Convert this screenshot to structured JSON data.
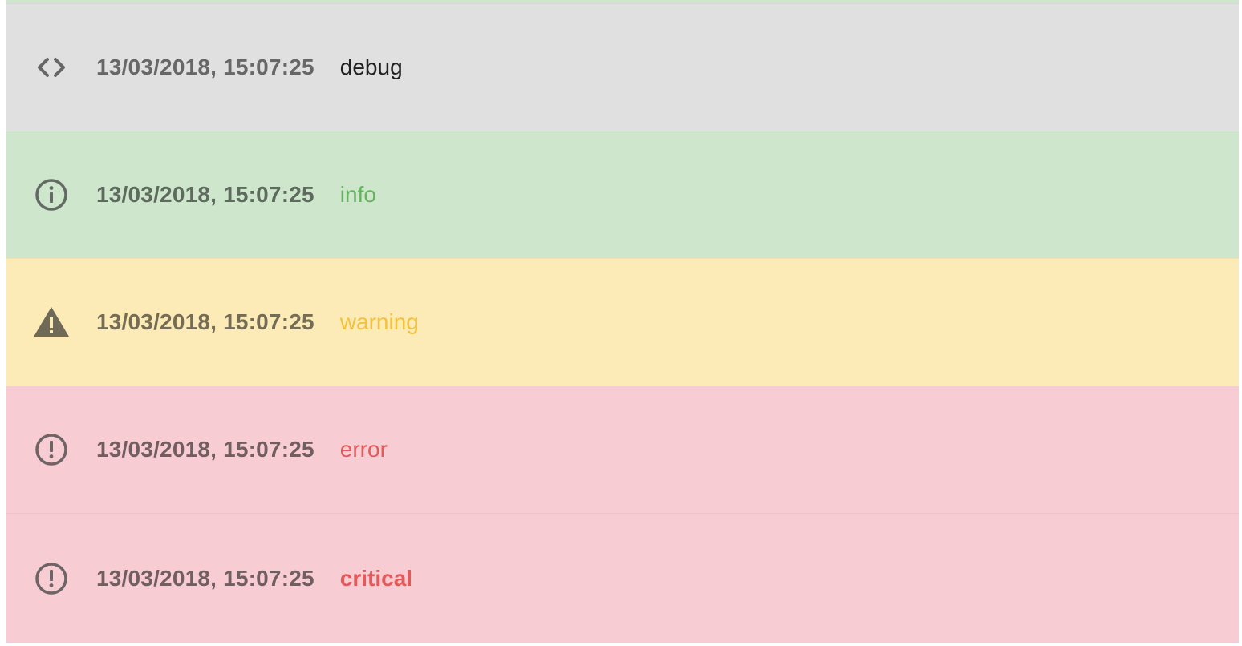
{
  "logs": [
    {
      "level": "debug",
      "timestamp": "13/03/2018, 15:07:25",
      "message": "debug",
      "icon": "code-icon"
    },
    {
      "level": "info",
      "timestamp": "13/03/2018, 15:07:25",
      "message": "info",
      "icon": "info-circle-icon"
    },
    {
      "level": "warning",
      "timestamp": "13/03/2018, 15:07:25",
      "message": "warning",
      "icon": "warning-triangle-icon"
    },
    {
      "level": "error",
      "timestamp": "13/03/2018, 15:07:25",
      "message": "error",
      "icon": "error-circle-icon"
    },
    {
      "level": "critical",
      "timestamp": "13/03/2018, 15:07:25",
      "message": "critical",
      "icon": "error-circle-icon"
    }
  ],
  "colors": {
    "debug_bg": "#e0e0e0",
    "info_bg": "#cde6cc",
    "warning_bg": "#fcebb7",
    "error_bg": "#f7ccd3",
    "info_text": "#66b35f",
    "warning_text": "#f2c23c",
    "error_text": "#e35a5a",
    "icon_color": "#6d6d6d"
  }
}
